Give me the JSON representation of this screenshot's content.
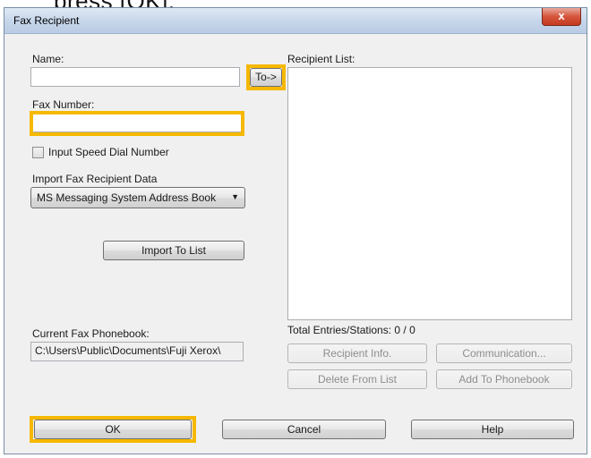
{
  "caption_cropped": "press [OK].",
  "window": {
    "title": "Fax Recipient",
    "close_glyph": "x"
  },
  "left": {
    "name_label": "Name:",
    "name_value": "",
    "to_button": "To->",
    "fax_number_label": "Fax Number:",
    "fax_number_value": "",
    "speed_dial_label": "Input Speed Dial Number",
    "speed_dial_checked": false,
    "import_label": "Import Fax Recipient Data",
    "import_selected": "MS Messaging System Address Book",
    "import_button": "Import To List",
    "phonebook_label": "Current Fax Phonebook:",
    "phonebook_path": "C:\\Users\\Public\\Documents\\Fuji Xerox\\"
  },
  "right": {
    "recipient_list_label": "Recipient List:",
    "recipients": [],
    "totals": "Total Entries/Stations: 0 / 0",
    "recipient_info_button": "Recipient Info.",
    "communication_button": "Communication...",
    "delete_button": "Delete From List",
    "add_phonebook_button": "Add To Phonebook"
  },
  "footer": {
    "ok": "OK",
    "cancel": "Cancel",
    "help": "Help"
  },
  "highlight_color": "#f6b800"
}
